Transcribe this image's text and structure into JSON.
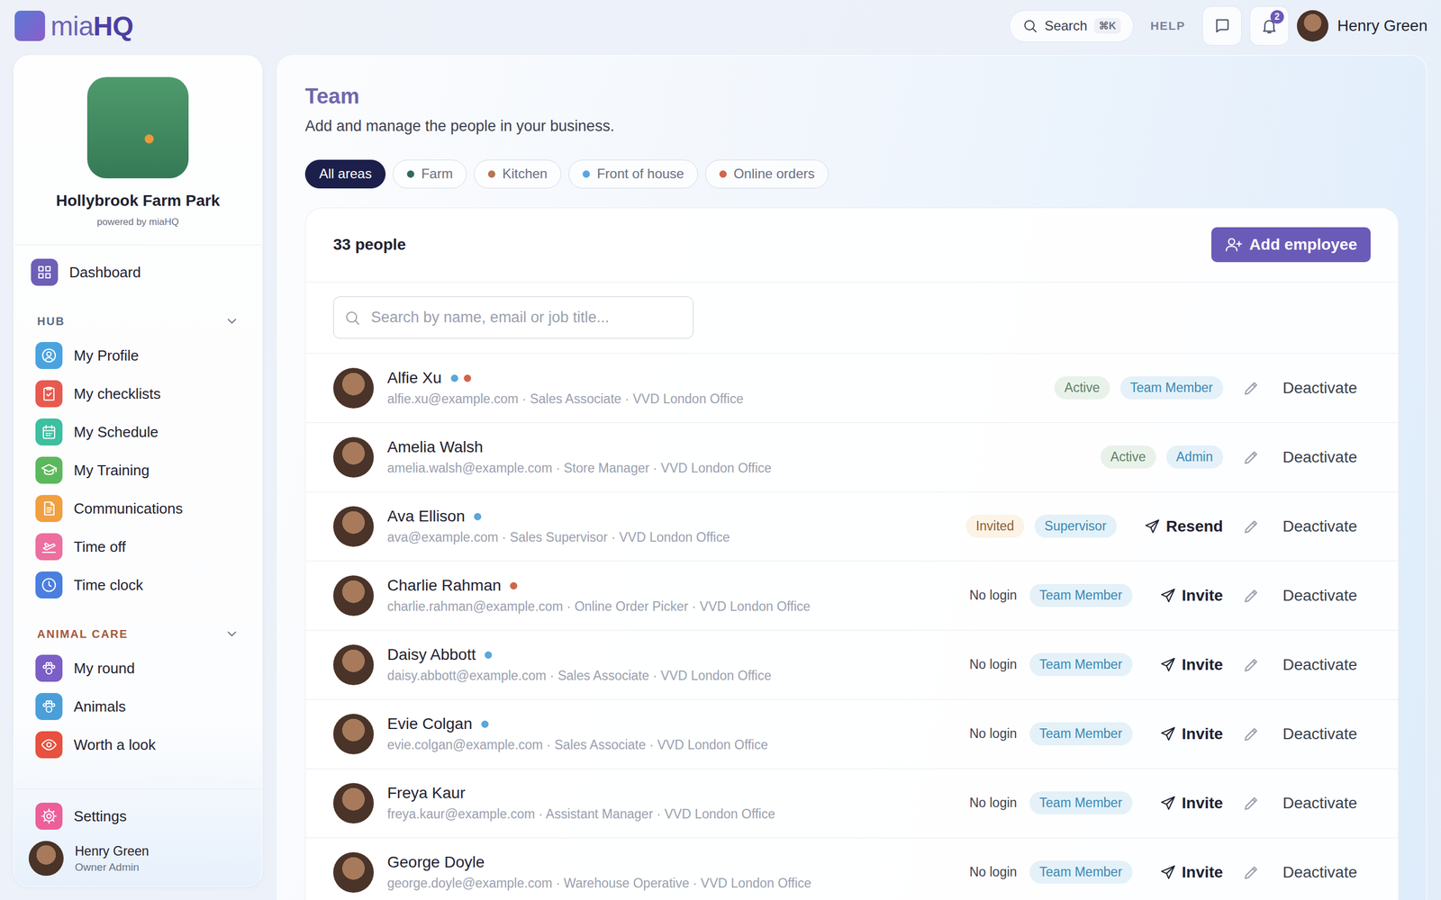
{
  "brand": {
    "name_start": "mia",
    "name_end": "HQ"
  },
  "topbar": {
    "search": {
      "label": "Search",
      "shortcut": "⌘K"
    },
    "help": "HELP",
    "notifications": {
      "count": "2"
    },
    "user": {
      "name": "Henry Green"
    }
  },
  "sidebar": {
    "business": {
      "name": "Hollybrook Farm Park",
      "powered_by": "powered by miaHQ"
    },
    "dashboard": {
      "label": "Dashboard",
      "color": "#6d5fb5"
    },
    "sections": [
      {
        "title": "HUB",
        "expanded": true,
        "color": "#5b6b86",
        "items": [
          {
            "label": "My Profile",
            "color": "#4aa3df"
          },
          {
            "label": "My checklists",
            "color": "#e85a4f"
          },
          {
            "label": "My Schedule",
            "color": "#3dbfa0"
          },
          {
            "label": "My Training",
            "color": "#5cb85c"
          },
          {
            "label": "Communications",
            "color": "#f0a040"
          },
          {
            "label": "Time off",
            "color": "#ec6fa0"
          },
          {
            "label": "Time clock",
            "color": "#4a7fe0"
          }
        ]
      },
      {
        "title": "ANIMAL CARE",
        "expanded": true,
        "color": "#a4573a",
        "items": [
          {
            "label": "My round",
            "color": "#7b5fc7"
          },
          {
            "label": "Animals",
            "color": "#4a9fd8"
          },
          {
            "label": "Worth a look",
            "color": "#e8503f"
          }
        ]
      }
    ],
    "settings": {
      "label": "Settings",
      "color": "#ec5f9a"
    },
    "user": {
      "name": "Henry Green",
      "role": "Owner Admin"
    }
  },
  "page": {
    "title": "Team",
    "subtitle": "Add and manage the people in your business."
  },
  "filters": [
    {
      "label": "All areas",
      "selected": true,
      "color": null
    },
    {
      "label": "Farm",
      "selected": false,
      "color": "#2e6b5f"
    },
    {
      "label": "Kitchen",
      "selected": false,
      "color": "#b8734f"
    },
    {
      "label": "Front of house",
      "selected": false,
      "color": "#5aa6dd"
    },
    {
      "label": "Online orders",
      "selected": false,
      "color": "#d0654a"
    }
  ],
  "team": {
    "count": "33 people",
    "add_button": "Add employee",
    "search": {
      "placeholder": "Search by name, email or job title..."
    },
    "rows": [
      {
        "name": "Alfie Xu",
        "meta": "alfie.xu@example.com · Sales Associate · VVD London Office",
        "dots": [
          {
            "color": "#5aa6dd"
          },
          {
            "color": "#d0654a"
          }
        ],
        "status": {
          "label": "Active",
          "kind": "active"
        },
        "role": "Team Member",
        "action": null,
        "deactivate": "Deactivate"
      },
      {
        "name": "Amelia Walsh",
        "meta": "amelia.walsh@example.com · Store Manager · VVD London Office",
        "dots": [],
        "status": {
          "label": "Active",
          "kind": "active"
        },
        "role": "Admin",
        "action": null,
        "deactivate": "Deactivate"
      },
      {
        "name": "Ava Ellison",
        "meta": "ava@example.com · Sales Supervisor · VVD London Office",
        "dots": [
          {
            "color": "#5aa6dd"
          }
        ],
        "status": {
          "label": "Invited",
          "kind": "invited"
        },
        "role": "Supervisor",
        "action": "Resend",
        "deactivate": "Deactivate"
      },
      {
        "name": "Charlie Rahman",
        "meta": "charlie.rahman@example.com · Online Order Picker · VVD London Office",
        "dots": [
          {
            "color": "#d0654a"
          }
        ],
        "status": {
          "label": "No login",
          "kind": "none"
        },
        "role": "Team Member",
        "action": "Invite",
        "deactivate": "Deactivate"
      },
      {
        "name": "Daisy Abbott",
        "meta": "daisy.abbott@example.com · Sales Associate · VVD London Office",
        "dots": [
          {
            "color": "#5aa6dd"
          }
        ],
        "status": {
          "label": "No login",
          "kind": "none"
        },
        "role": "Team Member",
        "action": "Invite",
        "deactivate": "Deactivate"
      },
      {
        "name": "Evie Colgan",
        "meta": "evie.colgan@example.com · Sales Associate · VVD London Office",
        "dots": [
          {
            "color": "#5aa6dd"
          }
        ],
        "status": {
          "label": "No login",
          "kind": "none"
        },
        "role": "Team Member",
        "action": "Invite",
        "deactivate": "Deactivate"
      },
      {
        "name": "Freya Kaur",
        "meta": "freya.kaur@example.com · Assistant Manager · VVD London Office",
        "dots": [],
        "status": {
          "label": "No login",
          "kind": "none"
        },
        "role": "Team Member",
        "action": "Invite",
        "deactivate": "Deactivate"
      },
      {
        "name": "George Doyle",
        "meta": "george.doyle@example.com · Warehouse Operative · VVD London Office",
        "dots": [],
        "status": {
          "label": "No login",
          "kind": "none"
        },
        "role": "Team Member",
        "action": "Invite",
        "deactivate": "Deactivate"
      }
    ]
  }
}
